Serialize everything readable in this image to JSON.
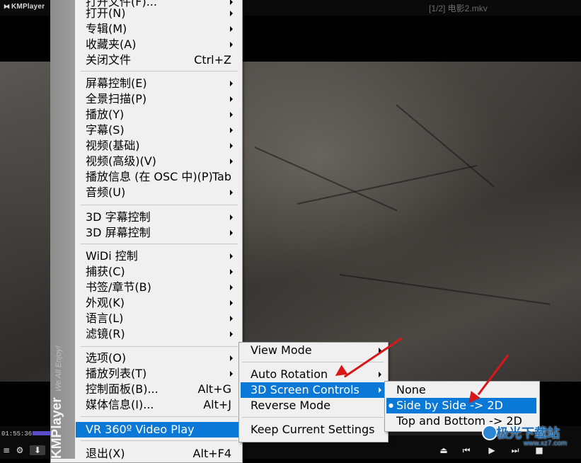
{
  "app": {
    "logo": "KMPlayer",
    "file_title": "[1/2] 电影2.mkv"
  },
  "player": {
    "time": "01:55:36",
    "progress_fraction": 0.04
  },
  "main_menu": {
    "sidebar_brand": "KMPlayer",
    "sidebar_slogan": "We All Enjoy!",
    "items": [
      {
        "label": "打开文件(F)...",
        "arrow": true
      },
      {
        "label": "打开(N)",
        "arrow": true
      },
      {
        "label": "专辑(M)",
        "arrow": true
      },
      {
        "label": "收藏夹(A)",
        "arrow": true
      },
      {
        "label": "关闭文件",
        "shortcut": "Ctrl+Z"
      },
      {
        "label": "屏幕控制(E)",
        "arrow": true
      },
      {
        "label": "全景扫描(P)",
        "arrow": true
      },
      {
        "label": "播放(Y)",
        "arrow": true
      },
      {
        "label": "字幕(S)",
        "arrow": true
      },
      {
        "label": "视频(基础)",
        "arrow": true
      },
      {
        "label": "视频(高级)(V)",
        "arrow": true
      },
      {
        "label": "播放信息 (在 OSC 中)(P)",
        "shortcut": "Tab"
      },
      {
        "label": "音频(U)",
        "arrow": true
      },
      {
        "label": "3D 字幕控制",
        "arrow": true
      },
      {
        "label": "3D 屏幕控制",
        "arrow": true
      },
      {
        "label": "WiDi 控制",
        "arrow": true
      },
      {
        "label": "捕获(C)",
        "arrow": true
      },
      {
        "label": "书签/章节(B)",
        "arrow": true
      },
      {
        "label": "外观(K)",
        "arrow": true
      },
      {
        "label": "语言(L)",
        "arrow": true
      },
      {
        "label": "滤镜(R)",
        "arrow": true
      },
      {
        "label": "选项(O)",
        "arrow": true
      },
      {
        "label": "播放列表(T)",
        "arrow": true
      },
      {
        "label": "控制面板(B)...",
        "shortcut": "Alt+G"
      },
      {
        "label": "媒体信息(I)...",
        "shortcut": "Alt+J"
      },
      {
        "label": "VR 360º Video Play",
        "arrow": true,
        "highlighted": true
      },
      {
        "label": "退出(X)",
        "shortcut": "Alt+F4"
      }
    ]
  },
  "vr_menu": {
    "items": [
      {
        "label": "View Mode",
        "arrow": true
      },
      {
        "label": "Auto Rotation",
        "arrow": true
      },
      {
        "label": "3D Screen Controls",
        "arrow": true,
        "highlighted": true
      },
      {
        "label": "Reverse Mode"
      },
      {
        "label": "Keep Current Settings"
      }
    ]
  },
  "screen3d_menu": {
    "items": [
      {
        "label": "None"
      },
      {
        "label": "Side by Side -> 2D",
        "checked": true,
        "highlighted": true
      },
      {
        "label": "Top and Bottom -> 2D"
      }
    ]
  },
  "watermark": {
    "text": "极光下载站",
    "url": "www.xz7.com"
  },
  "colors": {
    "highlight": "#0a78d7",
    "annotation_arrow": "#d81818",
    "menu_bg": "#f0f0f0"
  }
}
